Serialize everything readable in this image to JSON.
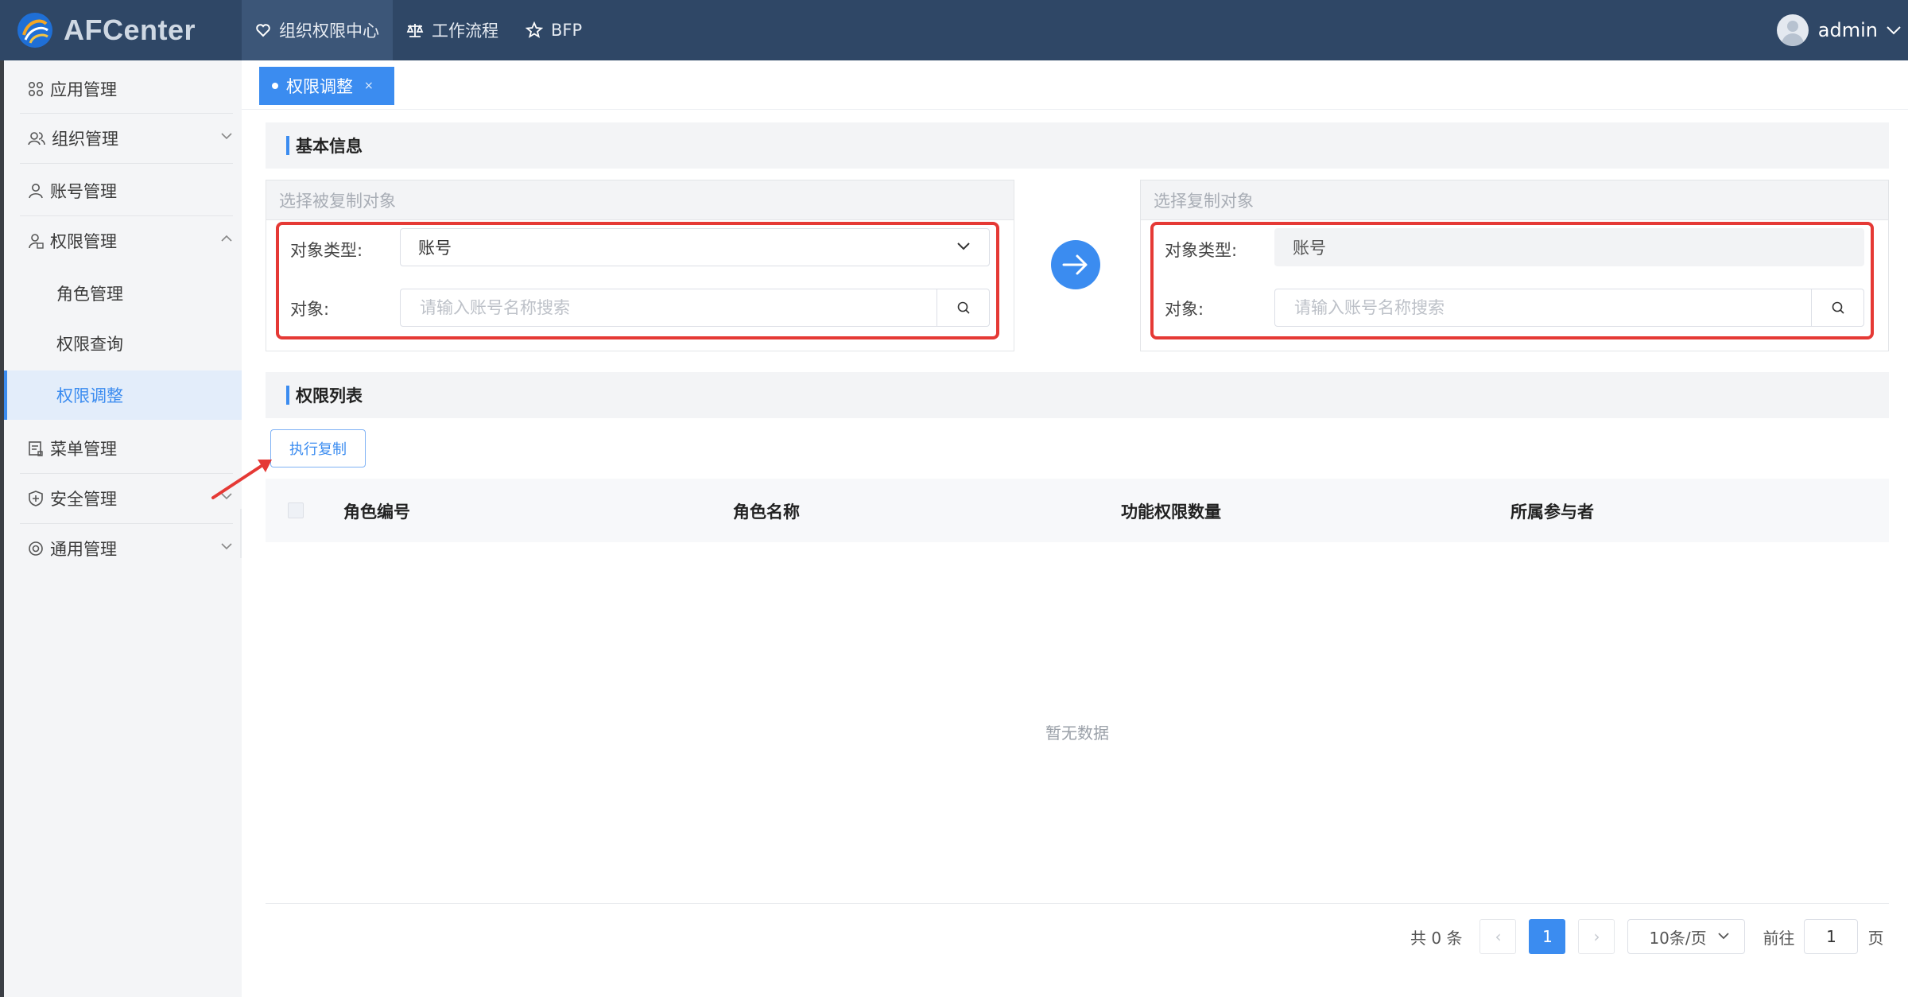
{
  "header": {
    "app_name": "AFCenter",
    "nav": [
      {
        "label": "组织权限中心",
        "icon": "heart-icon",
        "active": true
      },
      {
        "label": "工作流程",
        "icon": "scale-icon"
      },
      {
        "label": "BFP",
        "icon": "star-icon"
      }
    ],
    "user": "admin"
  },
  "sidebar": {
    "items": [
      {
        "label": "应用管理",
        "icon": "grid-icon"
      },
      {
        "label": "组织管理",
        "icon": "users-icon"
      },
      {
        "label": "账号管理",
        "icon": "user-icon"
      },
      {
        "label": "权限管理",
        "icon": "user-lock-icon"
      },
      {
        "label": "菜单管理",
        "icon": "menu-doc-icon"
      },
      {
        "label": "安全管理",
        "icon": "shield-icon"
      },
      {
        "label": "通用管理",
        "icon": "settings-icon"
      }
    ],
    "sub_items": [
      {
        "label": "角色管理"
      },
      {
        "label": "权限查询"
      },
      {
        "label": "权限调整",
        "active": true
      }
    ]
  },
  "tabs": [
    {
      "label": "权限调整",
      "close": "×"
    }
  ],
  "basic_info": {
    "title": "基本信息",
    "source_panel": {
      "title": "选择被复制对象",
      "type_label": "对象类型:",
      "type_value": "账号",
      "object_label": "对象:",
      "object_placeholder": "请输入账号名称搜索"
    },
    "target_panel": {
      "title": "选择复制对象",
      "type_label": "对象类型:",
      "type_value": "账号",
      "object_label": "对象:",
      "object_placeholder": "请输入账号名称搜索"
    }
  },
  "permission_list": {
    "title": "权限列表",
    "exec_button": "执行复制",
    "columns": [
      "角色编号",
      "角色名称",
      "功能权限数量",
      "所属参与者"
    ],
    "empty_text": "暂无数据"
  },
  "pagination": {
    "total": "共 0 条",
    "prev": "‹",
    "current_page": "1",
    "next": "›",
    "page_size": "10条/页",
    "goto_label": "前往",
    "goto_value": "1",
    "page_suffix": "页"
  },
  "colors": {
    "header_bg": "#2f4766",
    "accent": "#3b8cf0",
    "highlight_red": "#e53935"
  }
}
